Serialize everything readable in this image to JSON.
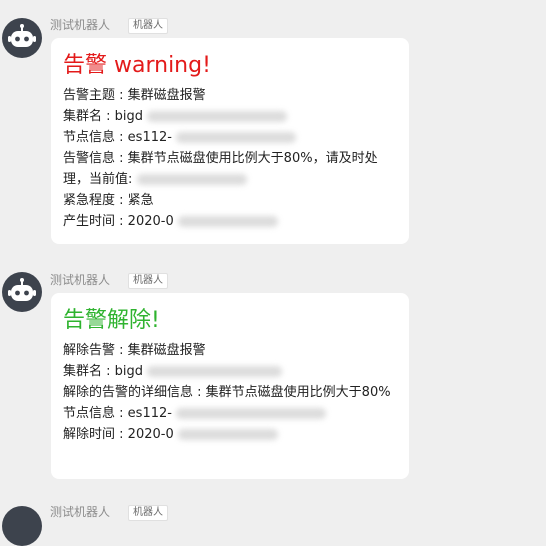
{
  "messages": [
    {
      "sender": "测试机器人",
      "tag": "机器人",
      "title": "告警 warning!",
      "rows": [
        {
          "label": "告警主题",
          "value": "集群磁盘报警"
        },
        {
          "label": "集群名",
          "value": "bigd"
        },
        {
          "label": "节点信息",
          "value": "es112-"
        },
        {
          "label": "告警信息",
          "value": "集群节点磁盘使用比例大于80%，请及时处理，当前值:"
        },
        {
          "label": "紧急程度",
          "value": "紧急"
        },
        {
          "label": "产生时间",
          "value": "2020-0"
        }
      ]
    },
    {
      "sender": "测试机器人",
      "tag": "机器人",
      "title": "告警解除!",
      "rows": [
        {
          "label": "解除告警",
          "value": "集群磁盘报警"
        },
        {
          "label": "集群名",
          "value": "bigd"
        },
        {
          "label": "解除的告警的详细信息",
          "value": "集群节点磁盘使用比例大于80%"
        },
        {
          "label": "节点信息",
          "value": "es112-"
        },
        {
          "label": "解除时间",
          "value": "2020-0"
        }
      ]
    },
    {
      "sender": "测试机器人",
      "tag": "机器人"
    }
  ],
  "separator": " : ",
  "colors": {
    "background": "#efefef",
    "alarm_title": "#e31a1a",
    "clear_title": "#2fb32f",
    "avatar": "#3d434d"
  },
  "icons": {
    "avatar": "robot-icon"
  }
}
